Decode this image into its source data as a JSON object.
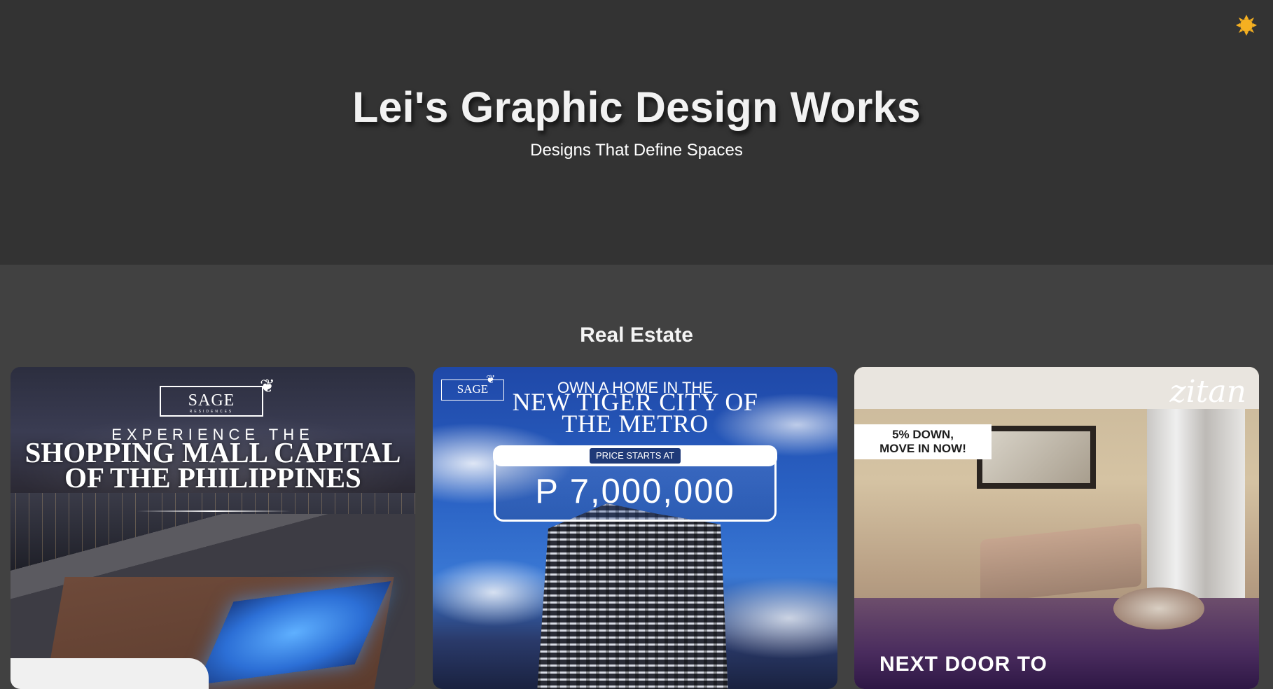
{
  "header": {
    "title": "Lei's Graphic Design Works",
    "subtitle": "Designs That Define Spaces"
  },
  "theme_toggle": {
    "icon": "sun-icon",
    "color": "#f5b021"
  },
  "section": {
    "title": "Real Estate"
  },
  "cards": [
    {
      "logo": "SAGE",
      "logo_sub": "RESIDENCES",
      "kicker": "EXPERIENCE THE",
      "headline_1": "SHOPPING MALL CAPITAL",
      "headline_2": "OF THE PHILIPPINES"
    },
    {
      "logo": "SAGE",
      "eyebrow": "OWN A HOME IN THE",
      "headline_1": "NEW TIGER CITY OF",
      "headline_2": "THE METRO",
      "price_label": "PRICE STARTS AT",
      "price": "P 7,000,000"
    },
    {
      "brand": "zitan",
      "badge_line_1": "5% DOWN,",
      "badge_line_2": "MOVE IN NOW!",
      "bottom_text": "NEXT DOOR TO"
    }
  ],
  "colors": {
    "hero_bg": "#333333",
    "page_bg": "#414141",
    "text": "#f2f2f2"
  }
}
